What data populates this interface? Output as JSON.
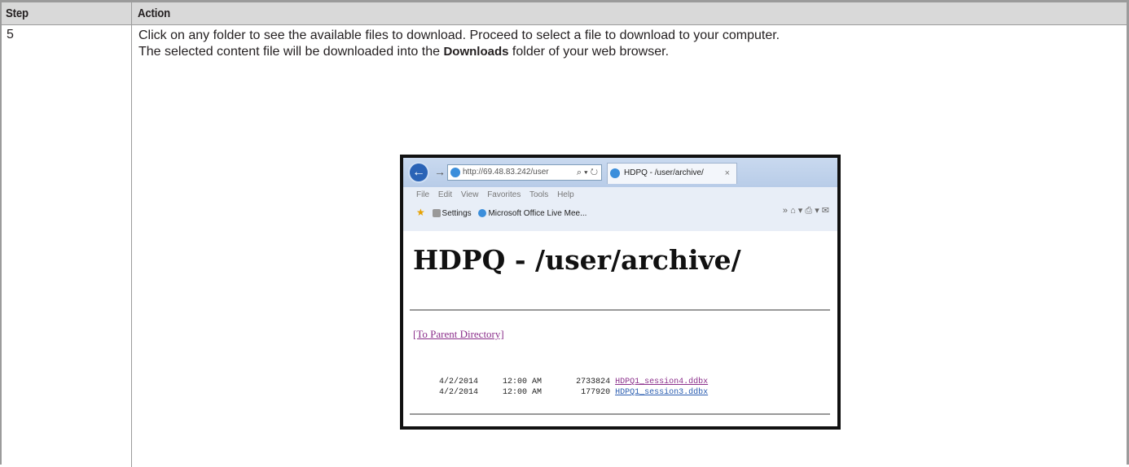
{
  "table": {
    "headers": [
      "Step",
      "Action"
    ],
    "row": {
      "step": "5",
      "line1": "Click on any folder to see the available files to download. Proceed to select a file to download to your computer.",
      "line2_pre": "The selected content file will be downloaded into the ",
      "line2_bold": "Downloads",
      "line2_post": " folder of your web browser."
    }
  },
  "browser": {
    "url": "http://69.48.83.242/user",
    "addr_tools": "⌕ ▾ ↻",
    "tab_title": "HDPQ - /user/archive/",
    "tab_close": "×",
    "menu": [
      "File",
      "Edit",
      "View",
      "Favorites",
      "Tools",
      "Help"
    ],
    "favorites": [
      "Settings",
      "Microsoft Office Live Mee..."
    ],
    "right_tools": "»   ⌂ ▾ ⎙ ▾ ✉",
    "page_heading": "HDPQ - /user/archive/",
    "parent_link": "[To Parent Directory]",
    "files": [
      {
        "date": "4/2/2014",
        "time": "12:00 AM",
        "size": "2733824",
        "name": "HDPQ1_session4.ddbx"
      },
      {
        "date": "4/2/2014",
        "time": "12:00 AM",
        "size": "177920",
        "name": "HDPQ1_session3.ddbx"
      }
    ]
  }
}
